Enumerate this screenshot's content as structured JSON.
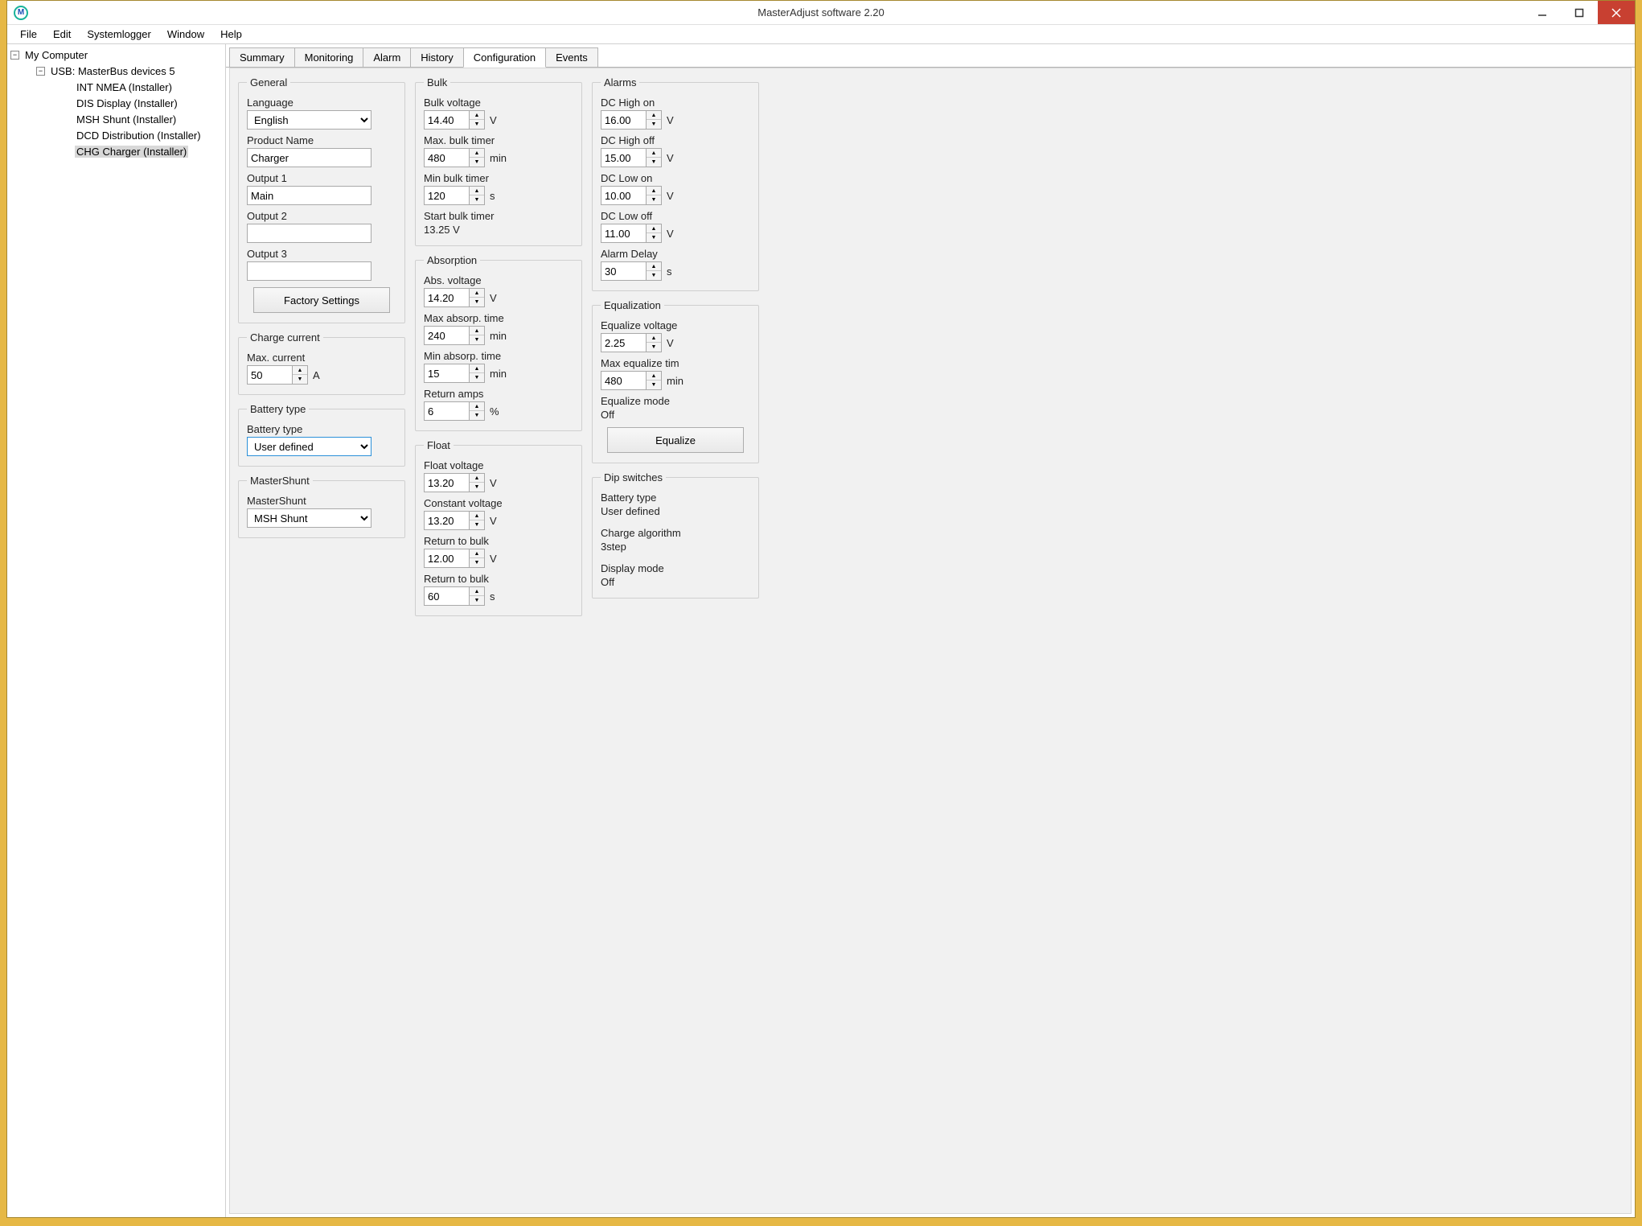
{
  "app": {
    "title": "MasterAdjust software 2.20"
  },
  "menu": {
    "file": "File",
    "edit": "Edit",
    "systemlogger": "Systemlogger",
    "window": "Window",
    "help": "Help"
  },
  "tree": {
    "root": "My Computer",
    "usb": "USB: MasterBus devices 5",
    "items": [
      "INT NMEA (Installer)",
      "DIS Display (Installer)",
      "MSH Shunt (Installer)",
      "DCD Distribution (Installer)",
      "CHG Charger (Installer)"
    ],
    "selected_index": 4
  },
  "tabs": {
    "items": [
      "Summary",
      "Monitoring",
      "Alarm",
      "History",
      "Configuration",
      "Events"
    ],
    "active_index": 4
  },
  "config": {
    "general": {
      "legend": "General",
      "language_label": "Language",
      "language_value": "English",
      "productname_label": "Product Name",
      "productname_value": "Charger",
      "output1_label": "Output 1",
      "output1_value": "Main",
      "output2_label": "Output 2",
      "output2_value": "",
      "output3_label": "Output 3",
      "output3_value": "",
      "factory_button": "Factory Settings"
    },
    "chargecurrent": {
      "legend": "Charge current",
      "maxcurrent_label": "Max. current",
      "maxcurrent_value": "50",
      "maxcurrent_unit": "A"
    },
    "batterytype": {
      "legend": "Battery type",
      "batterytype_label": "Battery type",
      "batterytype_value": "User defined"
    },
    "mastershunt": {
      "legend": "MasterShunt",
      "mastershunt_label": "MasterShunt",
      "mastershunt_value": "MSH Shunt"
    },
    "bulk": {
      "legend": "Bulk",
      "bulkvoltage_label": "Bulk voltage",
      "bulkvoltage_value": "14.40",
      "bulkvoltage_unit": "V",
      "maxbulktimer_label": "Max. bulk timer",
      "maxbulktimer_value": "480",
      "maxbulktimer_unit": "min",
      "minbulktimer_label": "Min bulk timer",
      "minbulktimer_value": "120",
      "minbulktimer_unit": "s",
      "startbulktimer_label": "Start bulk timer",
      "startbulktimer_value": "13.25 V"
    },
    "absorption": {
      "legend": "Absorption",
      "absvoltage_label": "Abs. voltage",
      "absvoltage_value": "14.20",
      "absvoltage_unit": "V",
      "maxabsorp_label": "Max absorp. time",
      "maxabsorp_value": "240",
      "maxabsorp_unit": "min",
      "minabsorp_label": "Min absorp. time",
      "minabsorp_value": "15",
      "minabsorp_unit": "min",
      "returnamps_label": "Return amps",
      "returnamps_value": "6",
      "returnamps_unit": "%"
    },
    "float": {
      "legend": "Float",
      "floatvoltage_label": "Float voltage",
      "floatvoltage_value": "13.20",
      "floatvoltage_unit": "V",
      "constantvoltage_label": "Constant voltage",
      "constantvoltage_value": "13.20",
      "constantvoltage_unit": "V",
      "returntobulk_v_label": "Return to bulk",
      "returntobulk_v_value": "12.00",
      "returntobulk_v_unit": "V",
      "returntobulk_s_label": "Return to bulk",
      "returntobulk_s_value": "60",
      "returntobulk_s_unit": "s"
    },
    "alarms": {
      "legend": "Alarms",
      "dchighon_label": "DC High on",
      "dchighon_value": "16.00",
      "dchighon_unit": "V",
      "dchighoff_label": "DC High off",
      "dchighoff_value": "15.00",
      "dchighoff_unit": "V",
      "dclowon_label": "DC Low on",
      "dclowon_value": "10.00",
      "dclowon_unit": "V",
      "dclowoff_label": "DC Low off",
      "dclowoff_value": "11.00",
      "dclowoff_unit": "V",
      "alarmdelay_label": "Alarm Delay",
      "alarmdelay_value": "30",
      "alarmdelay_unit": "s"
    },
    "equalization": {
      "legend": "Equalization",
      "equalizevoltage_label": "Equalize voltage",
      "equalizevoltage_value": "2.25",
      "equalizevoltage_unit": "V",
      "maxequalizetim_label": "Max equalize tim",
      "maxequalizetim_value": "480",
      "maxequalizetim_unit": "min",
      "equalizemode_label": "Equalize mode",
      "equalizemode_value": "Off",
      "equalize_button": "Equalize"
    },
    "dipswitches": {
      "legend": "Dip switches",
      "batterytype_label": "Battery type",
      "batterytype_value": "User defined",
      "chargealg_label": "Charge algorithm",
      "chargealg_value": "3step",
      "displaymode_label": "Display mode",
      "displaymode_value": "Off"
    }
  }
}
